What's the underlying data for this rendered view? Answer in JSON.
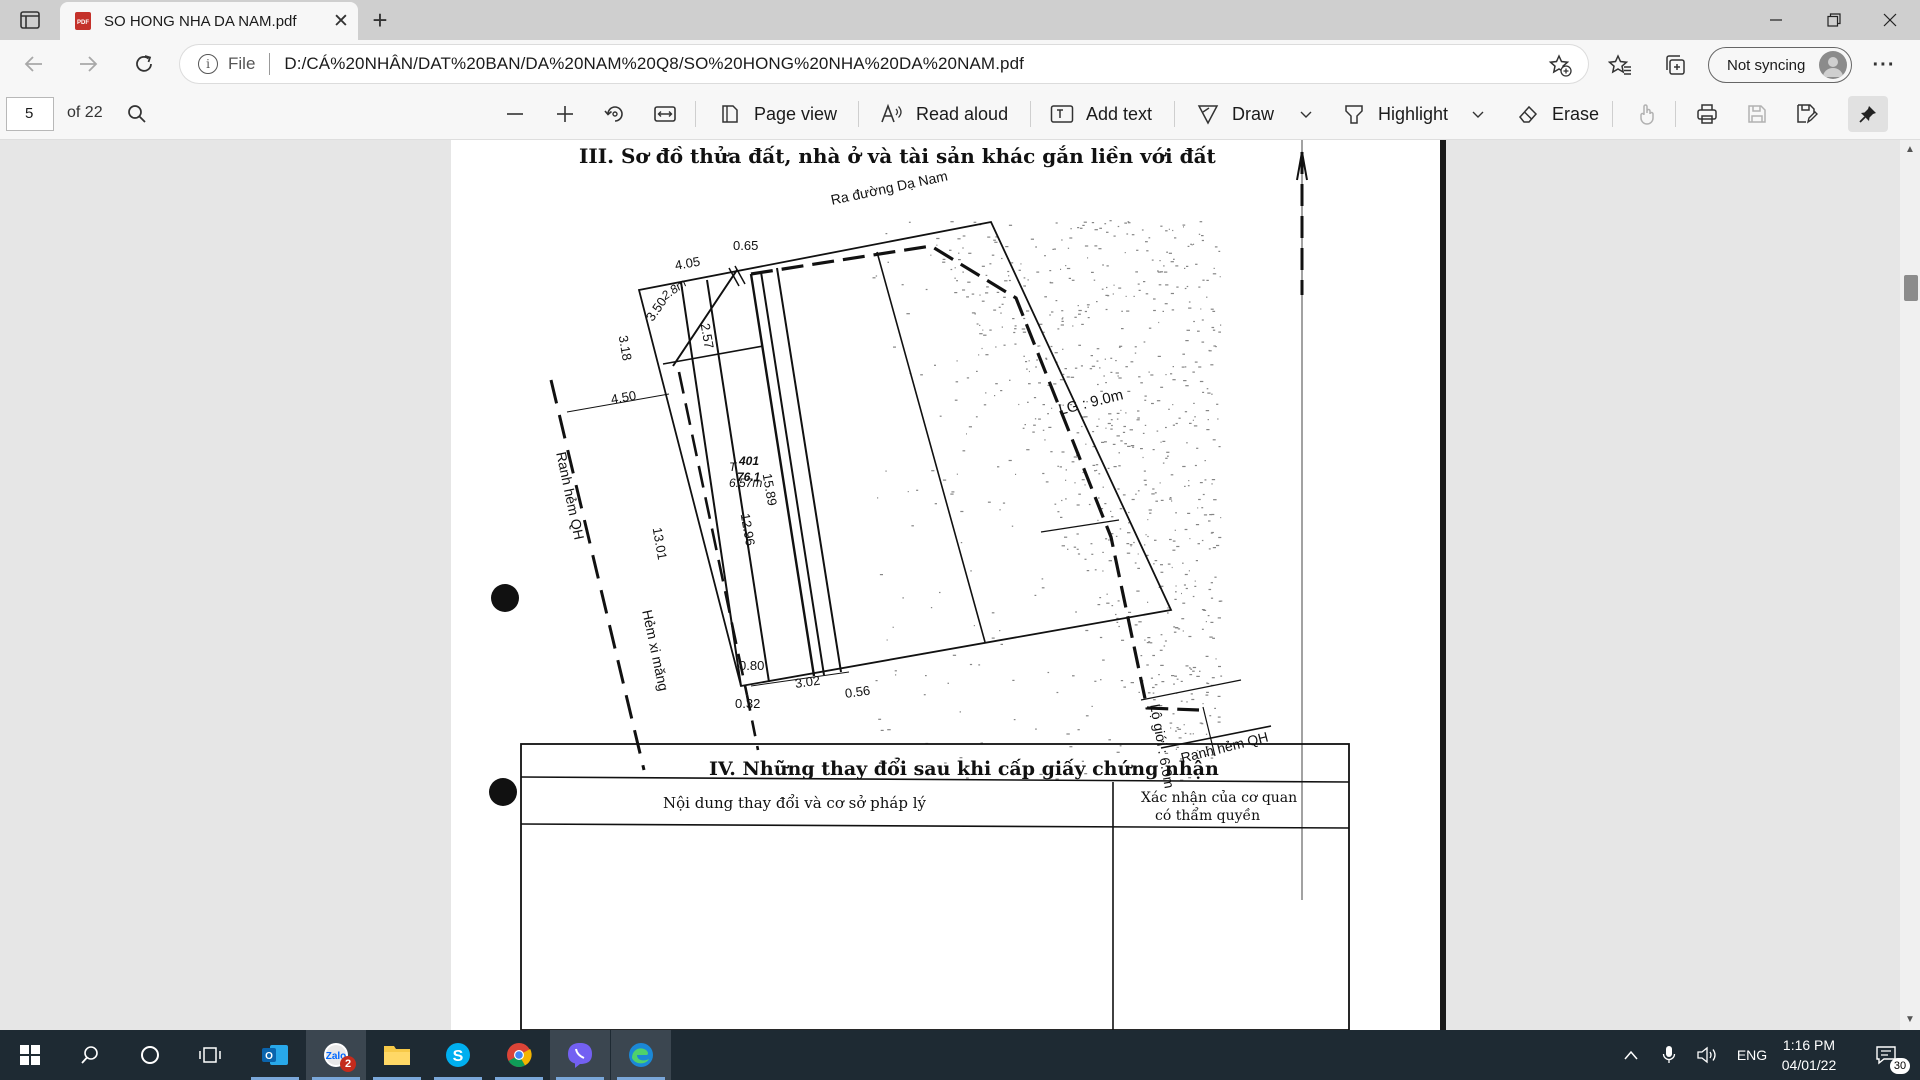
{
  "tab": {
    "title": "SO HONG NHA DA NAM.pdf"
  },
  "address": {
    "file_label": "File",
    "url": "D:/CÁ%20NHÂN/DAT%20BAN/DA%20NAM%20Q8/SO%20HONG%20NHA%20DA%20NAM.pdf"
  },
  "profile": {
    "sync_label": "Not syncing"
  },
  "pdf_toolbar": {
    "page_number": "5",
    "page_count": "of 22",
    "page_view": "Page view",
    "read_aloud": "Read aloud",
    "add_text": "Add text",
    "draw": "Draw",
    "highlight": "Highlight",
    "erase": "Erase"
  },
  "document": {
    "section3_title": "III. Sơ đồ thửa đất, nhà ở và tài sản khác gắn liền với đất",
    "section4_title": "IV. Những thay đổi sau khi cấp giấy chứng nhận",
    "col1_header": "Nội dung thay đổi và cơ sở pháp lý",
    "col2_header_line1": "Xác nhận của cơ quan",
    "col2_header_line2": "có thẩm quyền",
    "diagram_labels": {
      "road": "Ra đường Dạ Nam",
      "lg9": "LG : 9.0m",
      "lg6": "Lộ giới : 6.0m",
      "ranh_hem_left": "Ranh hẻm QH",
      "ranh_hem_right": "Ranh hẻm QH",
      "hem_xi_mang": "Hẻm xi măng",
      "d065": "0.65",
      "d405": "4.05",
      "d318": "3.18",
      "d350": "3.50",
      "d257": "2.57",
      "d450": "4.50",
      "d1301": "13.01",
      "d1296": "12.96",
      "d1589": "15.89",
      "d080": "0.80",
      "d032": "0.32",
      "d302": "3.02",
      "d056": "0.56",
      "t_num": "401",
      "t_area": "76.1",
      "t_prefix": "T",
      "d657": "6.57m",
      "d28": "2.8m"
    }
  },
  "taskbar": {
    "zalo_badge": "2",
    "lang": "ENG",
    "time": "1:16 PM",
    "date": "04/01/22",
    "notifications": "30"
  }
}
